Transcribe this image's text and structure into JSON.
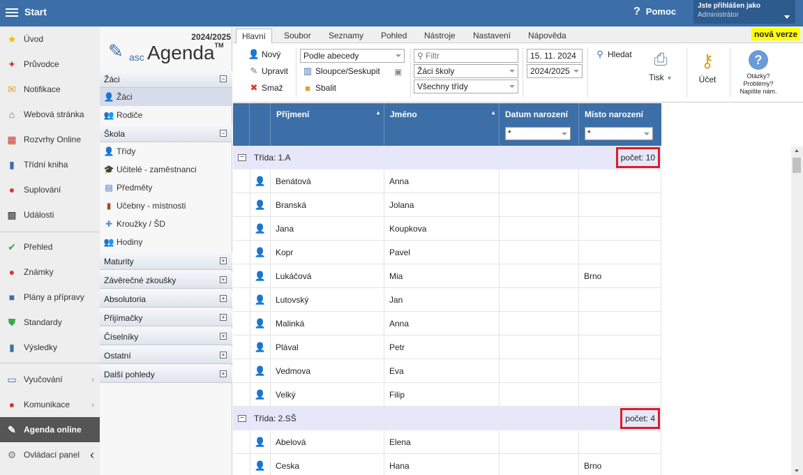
{
  "topbar": {
    "start_label": "Start",
    "help_label": "Pomoc",
    "user_line1": "Jste přihlášen jako",
    "user_line2": "Administrátor"
  },
  "leftnav": [
    {
      "label": "Úvod",
      "icon": "star-icon"
    },
    {
      "label": "Průvodce",
      "icon": "wand-icon"
    },
    {
      "label": "Notifikace",
      "icon": "envelope-icon"
    },
    {
      "label": "Webová stránka",
      "icon": "home-icon"
    },
    {
      "label": "Rozvrhy Online",
      "icon": "timetable-icon"
    },
    {
      "label": "Třídní kniha",
      "icon": "book-icon"
    },
    {
      "label": "Suplování",
      "icon": "person-icon"
    },
    {
      "label": "Události",
      "icon": "calendar-icon"
    },
    {
      "label": "Přehled",
      "icon": "check-circle-icon"
    },
    {
      "label": "Známky",
      "icon": "grades-icon"
    },
    {
      "label": "Plány a přípravy",
      "icon": "briefcase-icon"
    },
    {
      "label": "Standardy",
      "icon": "shield-icon"
    },
    {
      "label": "Výsledky",
      "icon": "bar-chart-icon"
    },
    {
      "label": "Vyučování",
      "icon": "open-book-icon"
    },
    {
      "label": "Komunikace",
      "icon": "chat-icon"
    },
    {
      "label": "Agenda online",
      "icon": "pen-icon"
    },
    {
      "label": "Ovládací panel",
      "icon": "gear-icon"
    }
  ],
  "tree": {
    "year": "2024/2025",
    "logo_asc": "asc",
    "logo_agenda": "Agenda",
    "logo_tm": "TM",
    "sections": [
      {
        "label": "Žáci",
        "items": [
          "Žáci",
          "Rodiče"
        ]
      },
      {
        "label": "Škola",
        "items": [
          "Třídy",
          "Učitelé - zaměstnanci",
          "Předměty",
          "Učebny - místnosti",
          "Kroužky / ŠD",
          "Hodiny"
        ]
      },
      {
        "label": "Maturity"
      },
      {
        "label": "Závěrečné zkoušky"
      },
      {
        "label": "Absolutoria"
      },
      {
        "label": "Přijímačky"
      },
      {
        "label": "Číselníky"
      },
      {
        "label": "Ostatní"
      },
      {
        "label": "Další pohledy"
      }
    ]
  },
  "tabs": [
    "Hlavní",
    "Soubor",
    "Seznamy",
    "Pohled",
    "Nástroje",
    "Nastavení",
    "Nápověda"
  ],
  "nova_verze": "nová verze",
  "ribbon": {
    "novy": "Nový",
    "upravit": "Upravit",
    "smaz": "Smaž",
    "sort": "Podle abecedy",
    "columns": "Sloupce/Seskupit",
    "collapse": "Sbalit",
    "filter_placeholder": "Filtr",
    "scope": "Žáci školy",
    "classes": "Všechny třídy",
    "date": "15. 11. 2024",
    "year": "2024/2025",
    "hledat": "Hledat",
    "tisk": "Tisk",
    "ucet": "Účet",
    "help_q": "Otázky? Problémy? Napište nám."
  },
  "grid": {
    "columns": [
      {
        "label": "Příjmení",
        "sort": "▲"
      },
      {
        "label": "Jméno",
        "sort": "▲"
      },
      {
        "label": "Datum narození",
        "filter": "*"
      },
      {
        "label": "Místo narození",
        "filter": "*"
      }
    ],
    "groups": [
      {
        "label": "Třída: 1.A",
        "count": "počet: 10",
        "rows": [
          [
            "Benátová",
            "Anna",
            "",
            ""
          ],
          [
            "Branská",
            "Jolana",
            "",
            ""
          ],
          [
            "Jana",
            "Koupkova",
            "",
            ""
          ],
          [
            "Kopr",
            "Pavel",
            "",
            ""
          ],
          [
            "Lukáčová",
            "Mia",
            "",
            "Brno"
          ],
          [
            "Lutovský",
            "Jan",
            "",
            ""
          ],
          [
            "Malinká",
            "Anna",
            "",
            ""
          ],
          [
            "Plával",
            "Petr",
            "",
            ""
          ],
          [
            "Vedmova",
            "Eva",
            "",
            ""
          ],
          [
            "Velký",
            "Filip",
            "",
            ""
          ]
        ]
      },
      {
        "label": "Třída: 2.SŠ",
        "count": "počet: 4",
        "rows": [
          [
            "Abelová",
            "Elena",
            "",
            ""
          ],
          [
            "Ceska",
            "Hana",
            "",
            "Brno"
          ]
        ]
      }
    ]
  }
}
